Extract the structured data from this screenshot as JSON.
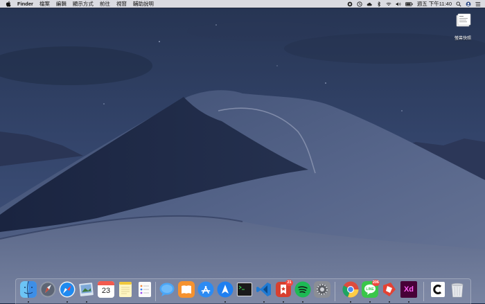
{
  "menubar": {
    "app_name": "Finder",
    "menus": [
      "檔案",
      "編輯",
      "顯示方式",
      "前往",
      "視窗",
      "輔助說明"
    ],
    "clock": "週五 下午11:40"
  },
  "desktop": {
    "icon_label": "螢幕快照"
  },
  "dock": {
    "items": [
      {
        "icon": "finder-icon",
        "running": true
      },
      {
        "icon": "launchpad-icon",
        "running": false
      },
      {
        "icon": "safari-icon",
        "running": true
      },
      {
        "icon": "preview-icon",
        "running": true
      },
      {
        "icon": "calendar-icon",
        "date": "23",
        "running": false
      },
      {
        "icon": "notes-icon",
        "running": false
      },
      {
        "icon": "reminders-icon",
        "running": false
      },
      {
        "icon": "messages-icon",
        "running": false
      },
      {
        "icon": "books-icon",
        "running": false
      },
      {
        "icon": "app-store-icon",
        "running": false
      },
      {
        "icon": "testflight-icon",
        "running": true
      },
      {
        "icon": "terminal-icon",
        "running": false
      },
      {
        "icon": "vscode-icon",
        "running": true
      },
      {
        "icon": "wunderlist-icon",
        "badge": "21",
        "running": true
      },
      {
        "icon": "spotify-icon",
        "running": true
      },
      {
        "icon": "system-preferences-icon",
        "running": false
      },
      {
        "icon": "chrome-icon",
        "running": true
      },
      {
        "icon": "line-icon",
        "badge": "206",
        "running": true
      },
      {
        "icon": "pdf-app-icon",
        "running": true
      },
      {
        "icon": "adobe-xd-icon",
        "label": "Xd",
        "running": true
      },
      {
        "icon": "cclean-icon",
        "running": false
      },
      {
        "icon": "trash-icon",
        "running": false
      }
    ]
  }
}
